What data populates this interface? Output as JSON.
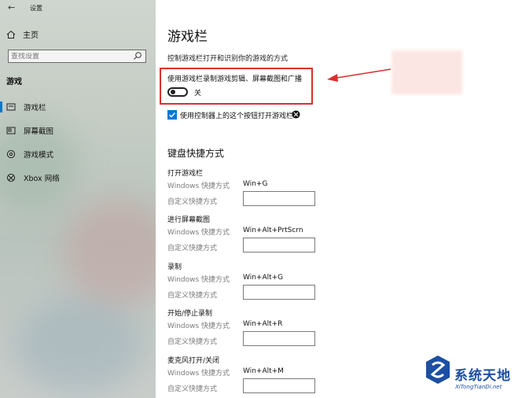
{
  "window": {
    "title": "设置"
  },
  "sidebar": {
    "home_label": "主页",
    "search_placeholder": "查找设置",
    "section_title": "游戏",
    "items": [
      {
        "label": "游戏栏",
        "icon": "game-bar-icon",
        "active": true
      },
      {
        "label": "屏幕截图",
        "icon": "screenshot-icon",
        "active": false
      },
      {
        "label": "游戏模式",
        "icon": "game-mode-icon",
        "active": false
      },
      {
        "label": "Xbox 网络",
        "icon": "xbox-icon",
        "active": false
      }
    ]
  },
  "main": {
    "title": "游戏栏",
    "description": "控制游戏栏打开和识别你的游戏的方式",
    "toggle": {
      "label": "使用游戏栏录制游戏剪辑、屏幕截图和广播",
      "state_label": "关",
      "on": false
    },
    "controller_checkbox": {
      "label": "使用控制器上的这个按钮打开游戏栏:",
      "checked": true
    },
    "keyboard_shortcuts": {
      "title": "键盘快捷方式",
      "windows_label": "Windows 快捷方式",
      "custom_label": "自定义快捷方式",
      "groups": [
        {
          "title": "打开游戏栏",
          "windows_shortcut": "Win+G",
          "custom_value": ""
        },
        {
          "title": "进行屏幕截图",
          "windows_shortcut": "Win+Alt+PrtScrn",
          "custom_value": ""
        },
        {
          "title": "录制",
          "windows_shortcut": "Win+Alt+G",
          "custom_value": ""
        },
        {
          "title": "开始/停止录制",
          "windows_shortcut": "Win+Alt+R",
          "custom_value": ""
        },
        {
          "title": "麦克风打开/关闭",
          "windows_shortcut": "Win+Alt+M",
          "custom_value": ""
        }
      ]
    }
  },
  "watermark": {
    "title": "系统天地",
    "subtitle": "XiTongTianDi.net"
  },
  "colors": {
    "accent": "#0078d7",
    "highlight_border": "#d9312f",
    "watermark": "#1c4fa3"
  }
}
